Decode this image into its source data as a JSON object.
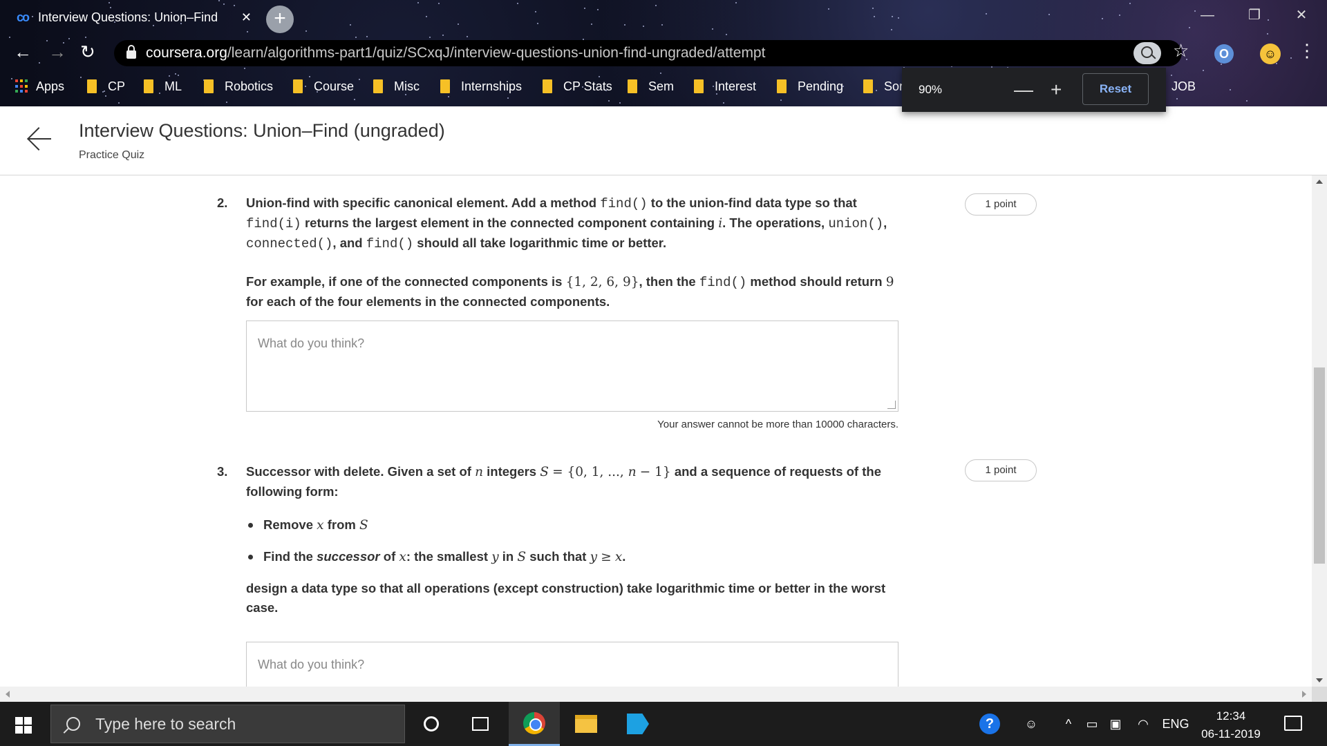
{
  "browser": {
    "tab_title": "Interview Questions: Union–Find",
    "tab_close": "✕",
    "new_tab": "+",
    "url_host": "coursera.org",
    "url_path": "/learn/algorithms-part1/quiz/SCxqJ/interview-questions-union-find-ungraded/attempt",
    "bookmarks": [
      "CP",
      "ML",
      "Robotics",
      "Course",
      "Misc",
      "Internships",
      "CP Stats",
      "Sem",
      "Interest",
      "Pending",
      "Sor",
      "JOB"
    ],
    "apps_label": "Apps",
    "zoom": {
      "percent": "90%",
      "minus": "—",
      "plus": "+",
      "reset": "Reset"
    }
  },
  "header": {
    "title": "Interview Questions: Union–Find (ungraded)",
    "subtitle": "Practice Quiz"
  },
  "questions": [
    {
      "number": "2.",
      "points": "1 point",
      "answer_placeholder": "What do you think?",
      "limit_note": "Your answer cannot be more than 10000 characters."
    },
    {
      "number": "3.",
      "points": "1 point",
      "answer_placeholder": "What do you think?"
    }
  ],
  "taskbar": {
    "search_placeholder": "Type here to search",
    "language": "ENG",
    "time": "12:34",
    "date": "06-11-2019"
  }
}
